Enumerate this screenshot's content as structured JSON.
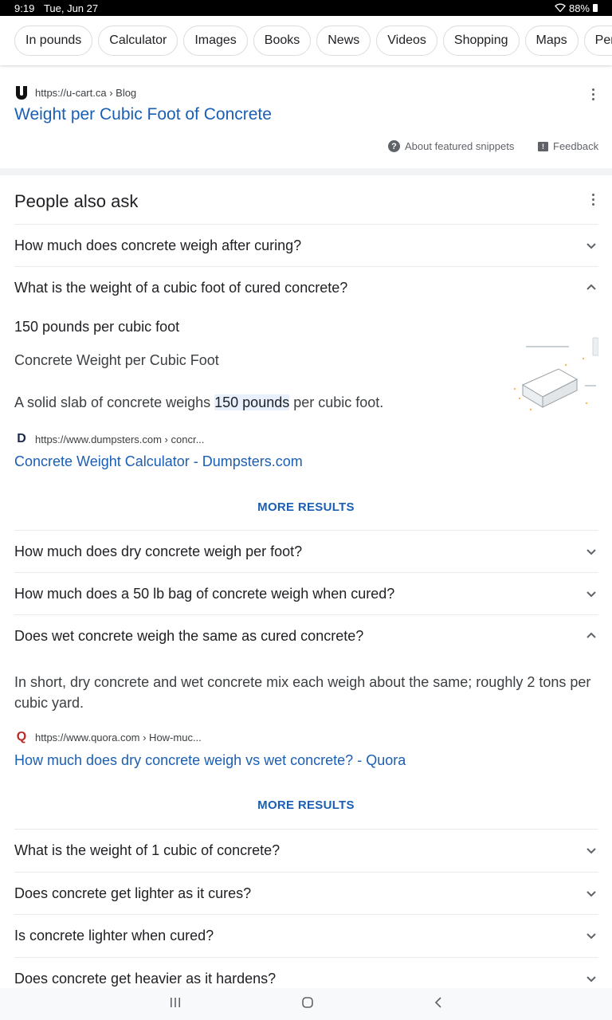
{
  "status": {
    "time": "9:19",
    "date": "Tue, Jun 27",
    "battery": "88%"
  },
  "chips": [
    "In pounds",
    "Calculator",
    "Images",
    "Books",
    "News",
    "Videos",
    "Shopping",
    "Maps",
    "Persp"
  ],
  "result1": {
    "url": "https://u-cart.ca › Blog",
    "title": "Weight per Cubic Foot of Concrete",
    "about": "About featured snippets",
    "feedback": "Feedback"
  },
  "paa": {
    "heading": "People also ask",
    "q1": "How much does concrete weigh after curing?",
    "q2": "What is the weight of a cubic foot of cured concrete?",
    "a2": {
      "short": "150 pounds per cubic foot",
      "subtitle": "Concrete Weight per Cubic Foot",
      "sentence_pre": "A solid slab of concrete weighs ",
      "sentence_hl": "150 pounds",
      "sentence_post": " per cubic foot.",
      "url": "https://www.dumpsters.com › concr...",
      "link": "Concrete Weight Calculator - Dumpsters.com",
      "more": "MORE RESULTS"
    },
    "q3": "How much does dry concrete weigh per foot?",
    "q4": "How much does a 50 lb bag of concrete weigh when cured?",
    "q5": "Does wet concrete weigh the same as cured concrete?",
    "a5": {
      "text": "In short, dry concrete and wet concrete mix each weigh about the same; roughly 2 tons per cubic yard.",
      "url": "https://www.quora.com › How-muc...",
      "link": "How much does dry concrete weigh vs wet concrete? - Quora",
      "more": "MORE RESULTS"
    },
    "q6": "What is the weight of 1 cubic of concrete?",
    "q7": "Does concrete get lighter as it cures?",
    "q8": "Is concrete lighter when cured?",
    "q9": "Does concrete get heavier as it hardens?"
  },
  "colors": {
    "link": "#1a5fb4",
    "text": "#202124",
    "muted": "#5f6368"
  }
}
